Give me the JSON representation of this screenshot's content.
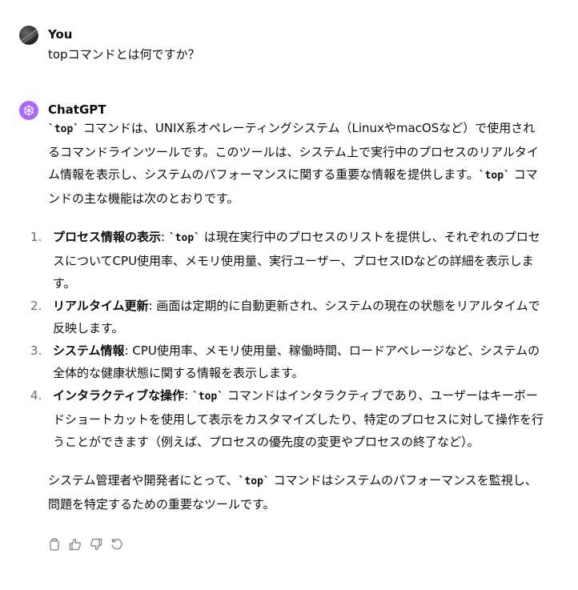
{
  "user_message": {
    "author": "You",
    "text": "topコマンドとは何ですか？"
  },
  "assistant_message": {
    "author": "ChatGPT",
    "intro": {
      "code": "`top`",
      "text": " コマンドは、UNIX系オペレーティングシステム（LinuxやmacOSなど）で使用されるコマンドラインツールです。このツールは、システム上で実行中のプロセスのリアルタイム情報を表示し、システムのパフォーマンスに関する重要な情報を提供します。",
      "code2": "`top`",
      "text2": " コマンドの主な機能は次のとおりです。"
    },
    "items": [
      {
        "num": "1.",
        "title": "プロセス情報の表示",
        "sep": ": ",
        "code": "`top`",
        "text": " は現在実行中のプロセスのリストを提供し、それぞれのプロセスについてCPU使用率、メモリ使用量、実行ユーザー、プロセスIDなどの詳細を表示します。"
      },
      {
        "num": "2.",
        "title": "リアルタイム更新",
        "sep": ": ",
        "text": "画面は定期的に自動更新され、システムの現在の状態をリアルタイムで反映します。"
      },
      {
        "num": "3.",
        "title": "システム情報",
        "sep": ": ",
        "text": "CPU使用率、メモリ使用量、稼働時間、ロードアベレージなど、システムの全体的な健康状態に関する情報を表示します。"
      },
      {
        "num": "4.",
        "title": "インタラクティブな操作",
        "sep": ": ",
        "code": "`top`",
        "text": " コマンドはインタラクティブであり、ユーザーはキーボードショートカットを使用して表示をカスタマイズしたり、特定のプロセスに対して操作を行うことができます（例えば、プロセスの優先度の変更やプロセスの終了など）。"
      }
    ],
    "outro": {
      "text1": "システム管理者や開発者にとって、",
      "code": "`top`",
      "text2": " コマンドはシステムのパフォーマンスを監視し、問題を特定するための重要なツールです。"
    }
  },
  "actions": {
    "icons": [
      "copy-icon",
      "thumbs-up-icon",
      "thumbs-down-icon",
      "regenerate-icon"
    ]
  }
}
